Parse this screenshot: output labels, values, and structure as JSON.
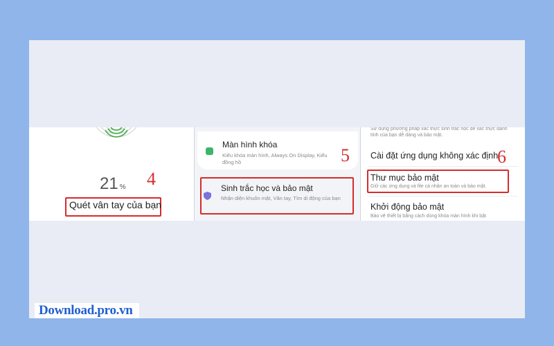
{
  "panel1": {
    "progress_percent": "21",
    "percent_sign": "%",
    "step": "4",
    "scan_label": "Quét vân tay của bạn"
  },
  "panel2": {
    "lock_title": "Màn hình khóa",
    "lock_sub": "Kiểu khóa màn hình, Always On Display, Kiểu đồng hồ",
    "step": "5",
    "bio_title": "Sinh trắc học và bảo mật",
    "bio_sub": "Nhận diện khuôn mặt, Vân tay, Tìm di động của bạn"
  },
  "panel3": {
    "top_sub": "Sử dụng phương pháp xác thực sinh trắc học để xác thực danh tính của bạn dễ dàng và bảo mật.",
    "unknown_apps": "Cài đặt ứng dụng không xác định",
    "step": "6",
    "secure_folder": "Thư mục bảo mật",
    "secure_folder_sub": "Giữ các ứng dụng và file cá nhân an toàn và bảo mật.",
    "secure_startup": "Khởi động bảo mật",
    "secure_startup_sub": "Bảo vệ thiết bị bằng cách dùng khóa màn hình khi bật"
  },
  "logo": "Download.pro.vn",
  "colors": {
    "accent_red": "#d52b2b",
    "background": "#8fb5ea",
    "logo_blue": "#1f5fd1",
    "fingerprint_green": "#4caf50",
    "shield_purple": "#7a73d9",
    "lock_green": "#3bb56b"
  }
}
